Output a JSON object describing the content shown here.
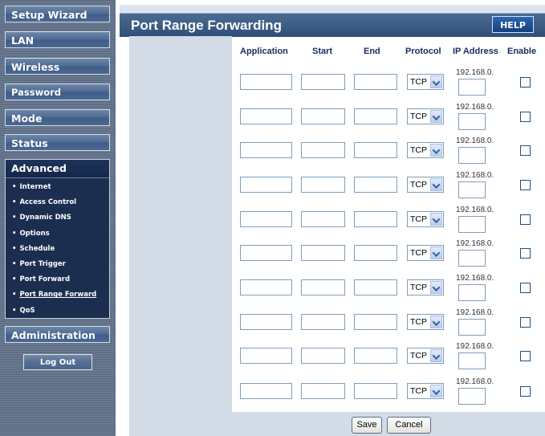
{
  "sidebar": {
    "nav_items": [
      {
        "label": "Setup Wizard"
      },
      {
        "label": "LAN"
      },
      {
        "label": "Wireless"
      },
      {
        "label": "Password"
      },
      {
        "label": "Mode"
      },
      {
        "label": "Status"
      }
    ],
    "advanced": {
      "label": "Advanced",
      "sub_items": [
        {
          "label": "Internet"
        },
        {
          "label": "Access Control"
        },
        {
          "label": "Dynamic DNS"
        },
        {
          "label": "Options"
        },
        {
          "label": "Schedule"
        },
        {
          "label": "Port Trigger"
        },
        {
          "label": "Port Forward"
        },
        {
          "label": "Port Range Forward",
          "active": true
        },
        {
          "label": "QoS"
        }
      ]
    },
    "administration_label": "Administration",
    "logout_label": "Log Out"
  },
  "header": {
    "title": "Port Range Forwarding",
    "help_label": "HELP"
  },
  "table": {
    "columns": {
      "application": "Application",
      "start": "Start",
      "end": "End",
      "protocol": "Protocol",
      "ip_address": "IP Address",
      "enable": "Enable"
    },
    "rows": [
      {
        "application": "",
        "start": "",
        "end": "",
        "protocol": "TCP",
        "ip_prefix": "192.168.0.",
        "ip_last": "",
        "enabled": false
      },
      {
        "application": "",
        "start": "",
        "end": "",
        "protocol": "TCP",
        "ip_prefix": "192.168.0.",
        "ip_last": "",
        "enabled": false
      },
      {
        "application": "",
        "start": "",
        "end": "",
        "protocol": "TCP",
        "ip_prefix": "192.168.0.",
        "ip_last": "",
        "enabled": false
      },
      {
        "application": "",
        "start": "",
        "end": "",
        "protocol": "TCP",
        "ip_prefix": "192.168.0.",
        "ip_last": "",
        "enabled": false
      },
      {
        "application": "",
        "start": "",
        "end": "",
        "protocol": "TCP",
        "ip_prefix": "192.168.0.",
        "ip_last": "",
        "enabled": false
      },
      {
        "application": "",
        "start": "",
        "end": "",
        "protocol": "TCP",
        "ip_prefix": "192.168.0.",
        "ip_last": "",
        "enabled": false
      },
      {
        "application": "",
        "start": "",
        "end": "",
        "protocol": "TCP",
        "ip_prefix": "192.168.0.",
        "ip_last": "",
        "enabled": false
      },
      {
        "application": "",
        "start": "",
        "end": "",
        "protocol": "TCP",
        "ip_prefix": "192.168.0.",
        "ip_last": "",
        "enabled": false
      },
      {
        "application": "",
        "start": "",
        "end": "",
        "protocol": "TCP",
        "ip_prefix": "192.168.0.",
        "ip_last": "",
        "enabled": false
      },
      {
        "application": "",
        "start": "",
        "end": "",
        "protocol": "TCP",
        "ip_prefix": "192.168.0.",
        "ip_last": "",
        "enabled": false
      }
    ]
  },
  "actions": {
    "save_label": "Save",
    "cancel_label": "Cancel"
  }
}
